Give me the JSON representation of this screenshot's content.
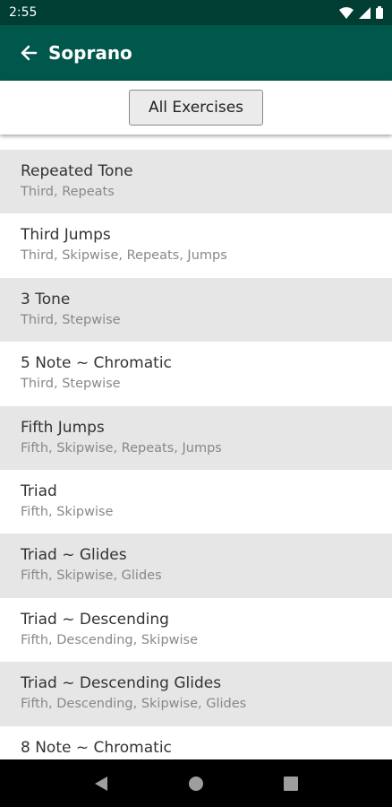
{
  "status": {
    "time": "2:55"
  },
  "app_bar": {
    "title": "Soprano"
  },
  "filter": {
    "label": "All Exercises"
  },
  "exercises": [
    {
      "title": "Repeated Tone",
      "tags": "Third, Repeats"
    },
    {
      "title": "Third Jumps",
      "tags": "Third, Skipwise, Repeats, Jumps"
    },
    {
      "title": "3 Tone",
      "tags": "Third, Stepwise"
    },
    {
      "title": "5 Note ~ Chromatic",
      "tags": "Third, Stepwise"
    },
    {
      "title": "Fifth Jumps",
      "tags": "Fifth, Skipwise, Repeats, Jumps"
    },
    {
      "title": "Triad",
      "tags": "Fifth, Skipwise"
    },
    {
      "title": "Triad ~ Glides",
      "tags": "Fifth, Skipwise, Glides"
    },
    {
      "title": "Triad ~ Descending",
      "tags": "Fifth, Descending, Skipwise"
    },
    {
      "title": "Triad ~ Descending Glides",
      "tags": "Fifth, Descending, Skipwise, Glides"
    },
    {
      "title": "8 Note ~ Chromatic",
      "tags": ""
    }
  ],
  "colors": {
    "status_bar": "#003d33",
    "app_bar": "#00574b",
    "row_alt": "#e6e6e6"
  }
}
